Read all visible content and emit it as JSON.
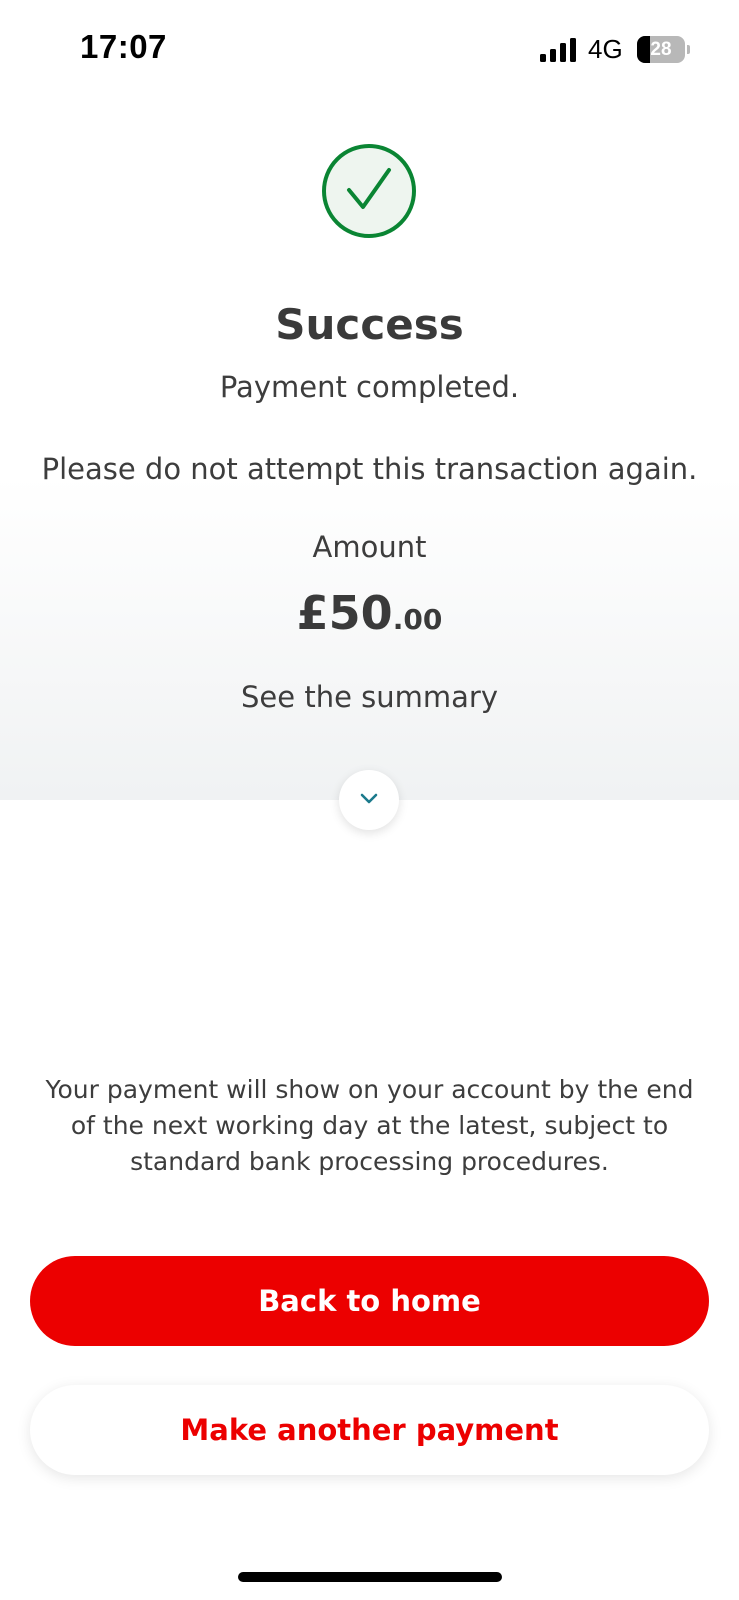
{
  "status_bar": {
    "time": "17:07",
    "network": "4G",
    "battery_level": "28",
    "battery_fraction": 0.28,
    "signal_icon": "signal-bars-icon"
  },
  "result": {
    "icon": "check-circle-icon",
    "icon_color": "#0a8533",
    "title": "Success",
    "subtitle": "Payment completed.",
    "warning": "Please do not attempt this transaction again."
  },
  "amount": {
    "label": "Amount",
    "major": "£50",
    "minor": ".00"
  },
  "summary": {
    "label": "See the summary",
    "toggle_icon": "chevron-down-icon",
    "toggle_color": "#1b7a8c"
  },
  "info": {
    "text": "Your payment will show on your account by the end of the next working day at the latest, subject to standard bank processing procedures."
  },
  "actions": {
    "primary_label": "Back to home",
    "secondary_label": "Make another payment",
    "brand_color": "#ec0000"
  }
}
